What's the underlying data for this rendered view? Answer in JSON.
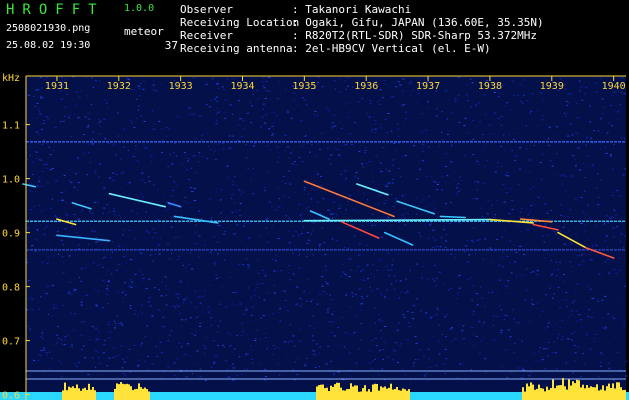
{
  "app": {
    "name": "HROFFT",
    "version": "1.0.0"
  },
  "file": {
    "name": "2508021930.png",
    "datetime": "25.08.02 19:30"
  },
  "meteor": {
    "label": "meteor",
    "count": "37"
  },
  "info": [
    {
      "key": "Observer",
      "value": ": Takanori Kawachi"
    },
    {
      "key": "Receiving Location",
      "value": ": Ogaki, Gifu, JAPAN (136.60E, 35.35N)"
    },
    {
      "key": "Receiver",
      "value": ": R820T2(RTL-SDR) SDR-Sharp 53.372MHz"
    },
    {
      "key": "Receiving antenna",
      "value": ": 2el-HB9CV Vertical (el. E-W)"
    }
  ],
  "colors": {
    "accent": "#39e639",
    "axis": "#ffd83a",
    "background": "#000000",
    "noise": "#0b1a8c"
  },
  "chart_data": {
    "type": "spectrogram",
    "ylabel": "kHz",
    "yticks": [
      "1.1",
      "1.0",
      "0.9",
      "0.8",
      "0.7",
      "0.6"
    ],
    "yrange": [
      0.59,
      1.19
    ],
    "xticks": [
      "1931",
      "1932",
      "1933",
      "1934",
      "1935",
      "1936",
      "1937",
      "1938",
      "1939",
      "1940"
    ],
    "xrange": [
      1930.5,
      1940.2
    ],
    "carriers": [
      {
        "freq": 1.068,
        "color": "#3a6cff"
      },
      {
        "freq": 0.921,
        "color": "#3ad0ff"
      },
      {
        "freq": 0.868,
        "color": "#2a4cd0"
      }
    ],
    "traces": [
      {
        "x0": 1930.45,
        "y0": 0.99,
        "x1": 1930.65,
        "y1": 0.985,
        "color": "#3ac8ff"
      },
      {
        "x0": 1931.85,
        "y0": 0.972,
        "x1": 1932.75,
        "y1": 0.948,
        "color": "#6cf0ff"
      },
      {
        "x0": 1932.8,
        "y0": 0.955,
        "x1": 1933.0,
        "y1": 0.948,
        "color": "#3a8cff"
      },
      {
        "x0": 1932.9,
        "y0": 0.93,
        "x1": 1933.6,
        "y1": 0.918,
        "color": "#3ac0ff"
      },
      {
        "x0": 1931.25,
        "y0": 0.955,
        "x1": 1931.55,
        "y1": 0.944,
        "color": "#3ac8ff"
      },
      {
        "x0": 1931.0,
        "y0": 0.925,
        "x1": 1931.3,
        "y1": 0.915,
        "color": "#ffe23a"
      },
      {
        "x0": 1931.0,
        "y0": 0.895,
        "x1": 1931.85,
        "y1": 0.885,
        "color": "#3ab0ff"
      },
      {
        "x0": 1935.85,
        "y0": 0.99,
        "x1": 1936.35,
        "y1": 0.97,
        "color": "#6cf0ff"
      },
      {
        "x0": 1935.0,
        "y0": 0.995,
        "x1": 1936.45,
        "y1": 0.93,
        "color": "#ff7a3a"
      },
      {
        "x0": 1936.5,
        "y0": 0.958,
        "x1": 1937.1,
        "y1": 0.935,
        "color": "#3ac8ff"
      },
      {
        "x0": 1935.1,
        "y0": 0.94,
        "x1": 1935.4,
        "y1": 0.925,
        "color": "#3ac0ff"
      },
      {
        "x0": 1935.6,
        "y0": 0.92,
        "x1": 1936.2,
        "y1": 0.89,
        "color": "#ff4a3a"
      },
      {
        "x0": 1936.3,
        "y0": 0.9,
        "x1": 1936.75,
        "y1": 0.877,
        "color": "#3ac0ff"
      },
      {
        "x0": 1935.0,
        "y0": 0.922,
        "x1": 1938.0,
        "y1": 0.924,
        "color": "#6cf0ff"
      },
      {
        "x0": 1938.0,
        "y0": 0.924,
        "x1": 1938.7,
        "y1": 0.918,
        "color": "#ffe23a"
      },
      {
        "x0": 1938.7,
        "y0": 0.915,
        "x1": 1939.1,
        "y1": 0.905,
        "color": "#ff4a3a"
      },
      {
        "x0": 1939.1,
        "y0": 0.9,
        "x1": 1939.55,
        "y1": 0.872,
        "color": "#ffe23a"
      },
      {
        "x0": 1939.55,
        "y0": 0.872,
        "x1": 1940.0,
        "y1": 0.853,
        "color": "#ff5a3a"
      },
      {
        "x0": 1937.2,
        "y0": 0.93,
        "x1": 1937.6,
        "y1": 0.928,
        "color": "#3ac8ff"
      },
      {
        "x0": 1938.5,
        "y0": 0.925,
        "x1": 1939.0,
        "y1": 0.92,
        "color": "#ff8a3a"
      }
    ]
  }
}
